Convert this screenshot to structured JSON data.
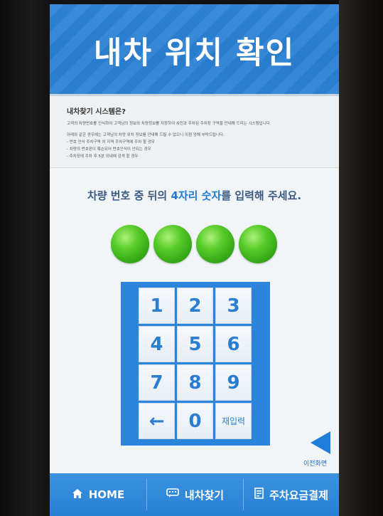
{
  "header": {
    "title": "내차 위치 확인"
  },
  "info": {
    "title": "내차찾기 시스템은?",
    "line1": "고객의 차량번호를 인식하여 고객님의 정보와 차량정보를 저장하여 사진과 주차된 주차장 구역을 안내해 드리는 시스템입니다.",
    "line2": "아래와 같은 경우에는 고객님의 차량 위치 정보를 안내해 드릴 수 없으니 이점 양해 부탁드립니다.",
    "line3": "- 번호 인식 주차구역 외 지역 주차구역에 주차 할 경우",
    "line4": "- 차량의 번호판이 훼손되어 번호인식이 안되는 경우",
    "line5": "- 주차장에 주차 후 5분 이내에 검색 할 경우"
  },
  "prompt": {
    "part1": "차량 번호 중 뒤의 ",
    "highlight": "4자리 숫자",
    "part2": "를 입력해 주세요."
  },
  "keypad": {
    "k1": "1",
    "k2": "2",
    "k3": "3",
    "k4": "4",
    "k5": "5",
    "k6": "6",
    "k7": "7",
    "k8": "8",
    "k9": "9",
    "kback": "←",
    "k0": "0",
    "kreset": "재입력"
  },
  "back": {
    "label": "이전화면"
  },
  "footer": {
    "home": "HOME",
    "find": "내차찾기",
    "pay": "주차요금결제"
  },
  "colors": {
    "accent": "#2a80d4",
    "dot": "#3cb518"
  },
  "icons": {
    "home": "home-icon",
    "find": "chat-icon",
    "pay": "receipt-icon",
    "back": "triangle-left-icon"
  }
}
